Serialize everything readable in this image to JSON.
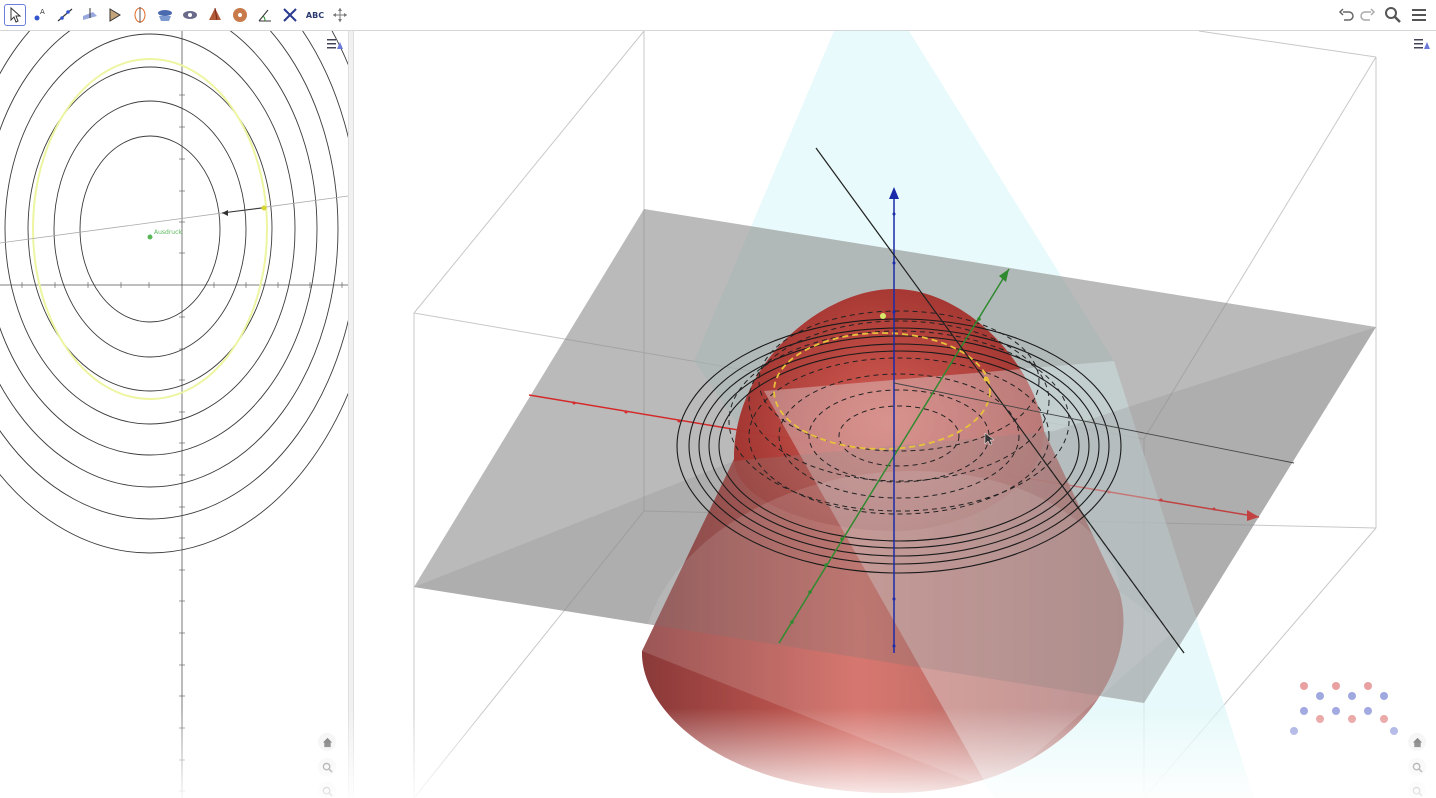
{
  "toolbar": {
    "tools": [
      {
        "name": "move-tool",
        "selected": true
      },
      {
        "name": "point-tool"
      },
      {
        "name": "line-tool"
      },
      {
        "name": "perpendicular-line-tool"
      },
      {
        "name": "polygon-tool"
      },
      {
        "name": "circle-axis-tool"
      },
      {
        "name": "intersect-surfaces-tool"
      },
      {
        "name": "plane-tool"
      },
      {
        "name": "pyramid-tool"
      },
      {
        "name": "sphere-tool"
      },
      {
        "name": "angle-tool"
      },
      {
        "name": "reflect-tool"
      },
      {
        "name": "text-tool",
        "label": "ABC"
      },
      {
        "name": "rotate-view-tool"
      }
    ],
    "right": [
      "undo-icon",
      "redo-icon",
      "search-icon",
      "menu-icon"
    ]
  },
  "graphics2d": {
    "point_label": "Ausdruck"
  },
  "colors": {
    "surface_red": "#b03830",
    "plane_gray": "#8c8c8c",
    "plane_cyan": "#d6f5f8",
    "x_axis": "#d42a2a",
    "y_axis": "#2f8a2f",
    "z_axis": "#1a2aa8",
    "highlight_yellow": "#e8c23a"
  }
}
